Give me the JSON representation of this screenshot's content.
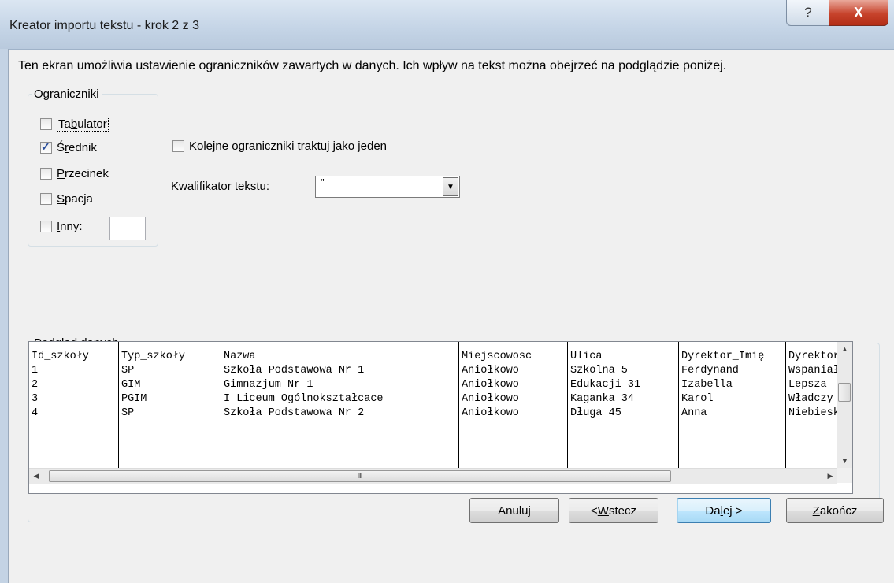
{
  "window": {
    "title": "Kreator importu tekstu - krok 2 z 3",
    "help_glyph": "?",
    "close_glyph": "X"
  },
  "description": "Ten ekran umożliwia ustawienie ograniczników zawartych w danych. Ich wpływ na tekst można obejrzeć na podglądzie poniżej.",
  "delimiters": {
    "legend": "Ograniczniki",
    "tab": {
      "pre": "Ta",
      "ul": "b",
      "post": "ulator",
      "checked": false
    },
    "semicolon": {
      "pre": "Ś",
      "ul": "r",
      "post": "ednik",
      "checked": true
    },
    "comma": {
      "pre": "",
      "ul": "P",
      "post": "rzecinek",
      "checked": false
    },
    "space": {
      "pre": "",
      "ul": "S",
      "post": "pacja",
      "checked": false
    },
    "other": {
      "pre": "",
      "ul": "I",
      "post": "nny:",
      "checked": false,
      "value": ""
    }
  },
  "consecutive": {
    "pre": "Kole",
    "ul": "j",
    "post": "ne ograniczniki traktuj jako jeden",
    "checked": false
  },
  "qualifier": {
    "pre": "Kwali",
    "ul": "f",
    "post": "ikator tekstu:",
    "value": "\""
  },
  "preview": {
    "legend_pre": "Podgląd danyc",
    "legend_ul": "h",
    "columns": [
      [
        "Id_szkoły",
        "1",
        "2",
        "3",
        "4"
      ],
      [
        "Typ_szkoły",
        "SP",
        "GIM",
        "PGIM",
        "SP"
      ],
      [
        "Nazwa",
        "Szkoła Podstawowa Nr 1",
        "Gimnazjum Nr 1",
        "I Liceum Ogólnokształcace",
        "Szkoła Podstawowa Nr 2"
      ],
      [
        "Miejscowosc",
        "Aniołkowo",
        "Aniołkowo",
        "Aniołkowo",
        "Aniołkowo"
      ],
      [
        "Ulica",
        "Szkolna 5",
        "Edukacji 31",
        "Kaganka 34",
        "Długa 45"
      ],
      [
        "Dyrektor_Imię",
        "Ferdynand",
        "Izabella",
        "Karol",
        "Anna"
      ],
      [
        "Dyrektor_Nazwisko",
        "Wspaniały",
        "Lepsza",
        "Władczy",
        "Niebieska"
      ]
    ],
    "hscroll_grip": "III"
  },
  "buttons": {
    "cancel": {
      "pre": "Anuluj",
      "ul": "",
      "post": ""
    },
    "back": {
      "pre": "< ",
      "ul": "W",
      "post": "stecz"
    },
    "next": {
      "pre": "Da",
      "ul": "l",
      "post": "ej >"
    },
    "finish": {
      "pre": "",
      "ul": "Z",
      "post": "akończ"
    }
  }
}
